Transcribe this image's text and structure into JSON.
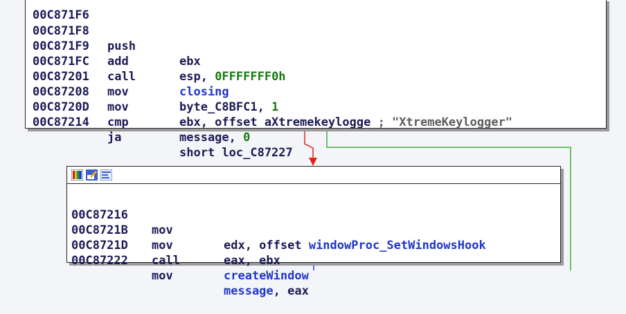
{
  "top_block": {
    "partial_line": "00C871F6",
    "lines": [
      {
        "addr": "00C871F8",
        "mnemonic": "push",
        "op_a": "ebx",
        "op_b": "",
        "comment": ""
      },
      {
        "addr": "00C871F9",
        "mnemonic": "add",
        "op_a": "esp, ",
        "op_b": "0FFFFFFF0h",
        "comment": ""
      },
      {
        "addr": "00C871FC",
        "mnemonic": "call",
        "op_a": "closing",
        "op_b": "",
        "comment": ""
      },
      {
        "addr": "00C87201",
        "mnemonic": "mov",
        "op_a": "byte_C8BFC1, ",
        "op_b": "1",
        "comment": ""
      },
      {
        "addr": "00C87208",
        "mnemonic": "mov",
        "op_a": "ebx, offset aXtremekeylogge",
        "op_b": "",
        "comment": " ; \"XtremeKeylogger\""
      },
      {
        "addr": "00C8720D",
        "mnemonic": "cmp",
        "op_a": "message, ",
        "op_b": "0",
        "comment": ""
      },
      {
        "addr": "00C87214",
        "mnemonic": "ja",
        "op_a": "short loc_C87227",
        "op_b": "",
        "comment": ""
      }
    ]
  },
  "bottom_block": {
    "lines": [
      {
        "addr": "00C87216",
        "mnemonic": "mov",
        "op_a": "edx, offset ",
        "op_b": "windowProc_SetWindowsHook"
      },
      {
        "addr": "00C8721B",
        "mnemonic": "mov",
        "op_a": "eax, ebx",
        "op_b": ""
      },
      {
        "addr": "00C8721D",
        "mnemonic": "call",
        "op_a": "",
        "op_b": "createWindow"
      },
      {
        "addr": "00C87222",
        "mnemonic": "mov",
        "op_a": "",
        "op_b": "message",
        "op_c": ", eax"
      }
    ]
  },
  "toolbar_icons": [
    "color-palette-icon",
    "edit-block-icon",
    "graph-view-icon"
  ],
  "colors": {
    "background": "#f4f5f8",
    "edge_false": "#e0241e",
    "edge_true": "#3fae3f",
    "edge_flow": "#2a3fd0",
    "address": "#1a1a55",
    "symbol_blue": "#1f36c8",
    "immediate_green": "#157a10",
    "comment_gray": "#5d5d5d"
  }
}
